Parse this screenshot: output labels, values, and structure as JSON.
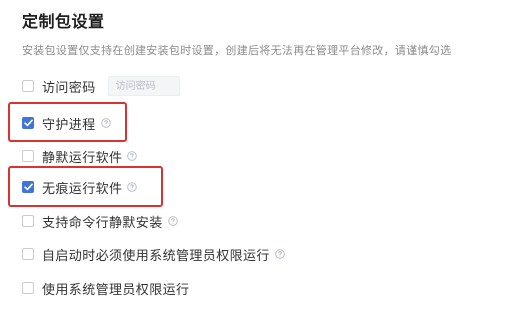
{
  "section": {
    "title": "定制包设置",
    "description": "安装包设置仅支持在创建安装包时设置，创建后将无法再在管理平台修改，请谨慎勾选"
  },
  "options": [
    {
      "label": "访问密码",
      "checked": false,
      "has_help": false,
      "input_placeholder": "访问密码"
    },
    {
      "label": "守护进程",
      "checked": true,
      "has_help": true
    },
    {
      "label": "静默运行软件",
      "checked": false,
      "has_help": true
    },
    {
      "label": "无痕运行软件",
      "checked": true,
      "has_help": true
    },
    {
      "label": "支持命令行静默安装",
      "checked": false,
      "has_help": true
    },
    {
      "label": "自启动时必须使用系统管理员权限运行",
      "checked": false,
      "has_help": true
    },
    {
      "label": "使用系统管理员权限运行",
      "checked": false,
      "has_help": false
    }
  ],
  "colors": {
    "accent": "#3f76d8",
    "highlight": "#d9332f"
  }
}
